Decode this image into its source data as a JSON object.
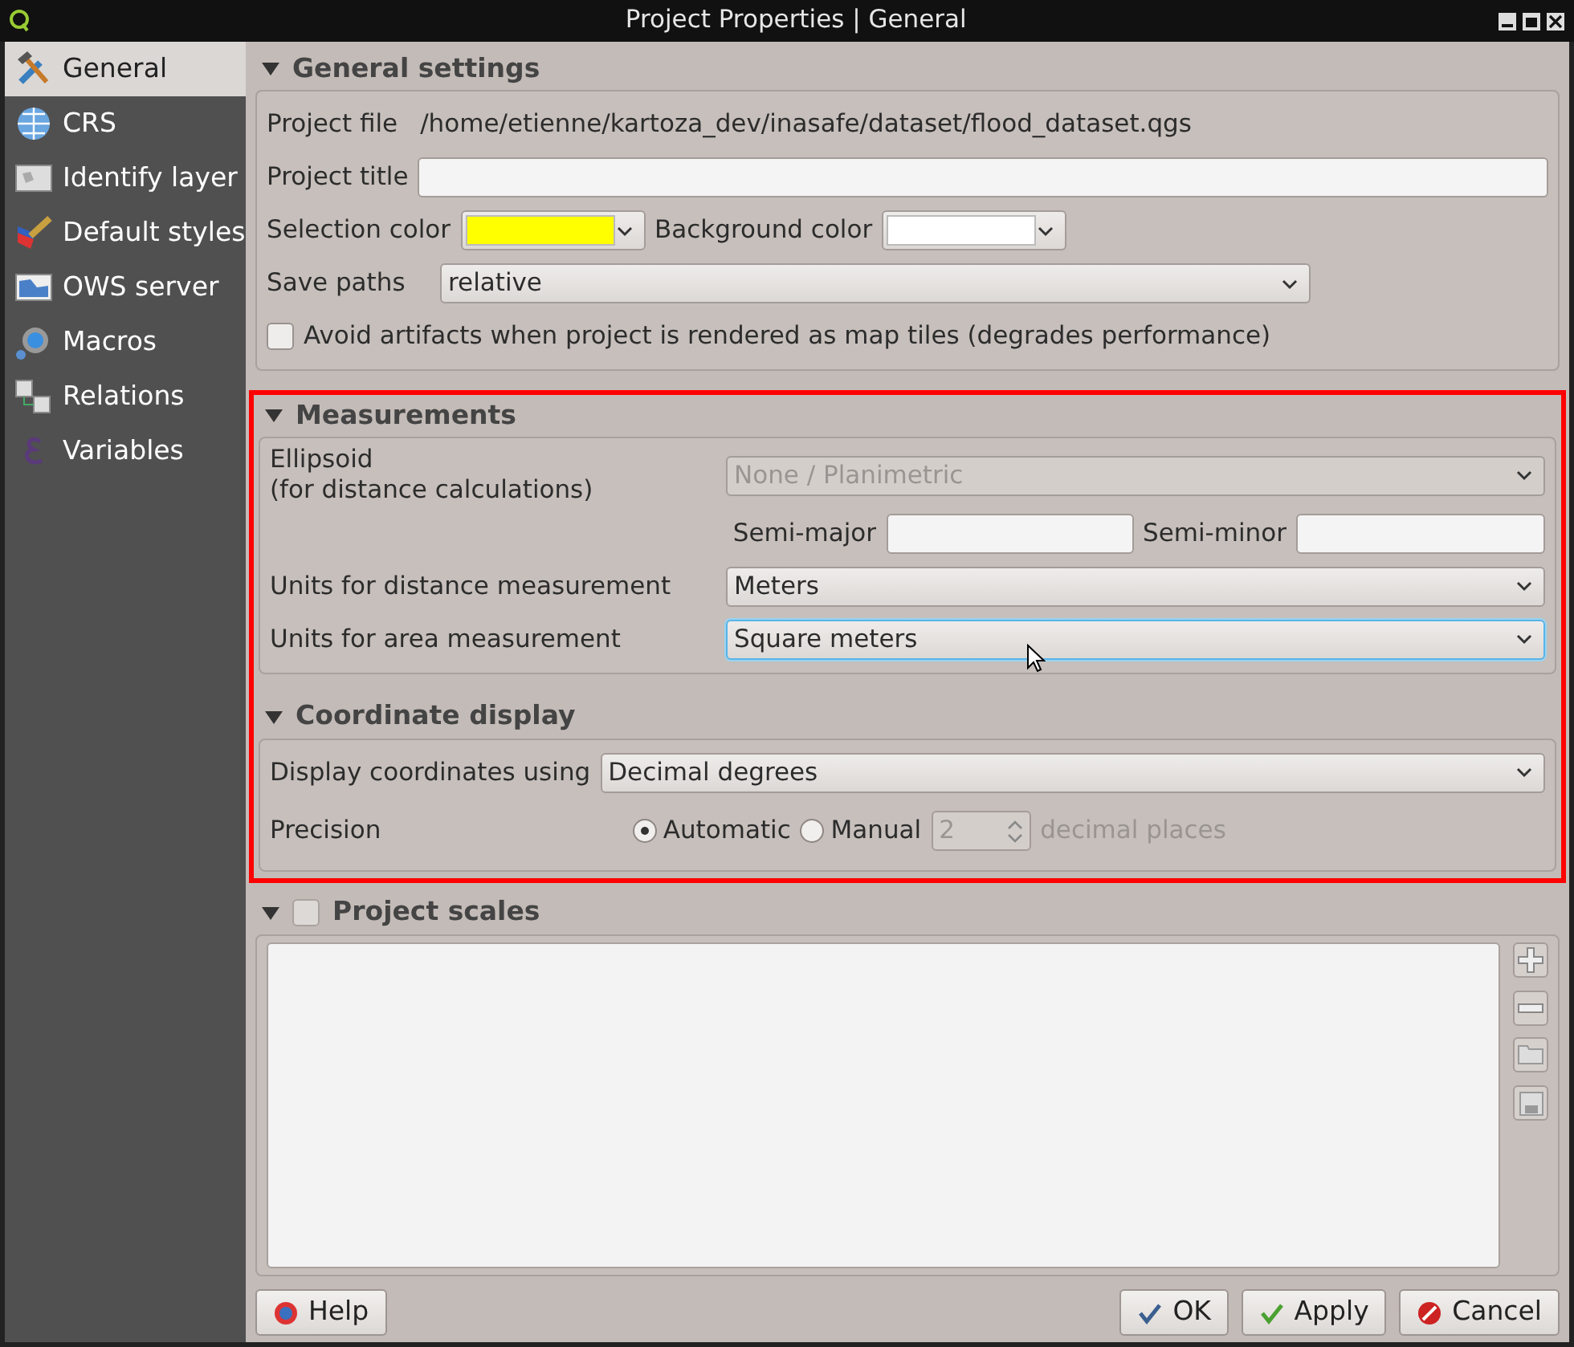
{
  "window": {
    "title": "Project Properties | General"
  },
  "sidebar": {
    "items": [
      {
        "label": "General",
        "selected": true
      },
      {
        "label": "CRS",
        "selected": false
      },
      {
        "label": "Identify layer",
        "selected": false
      },
      {
        "label": "Default styles",
        "selected": false
      },
      {
        "label": "OWS server",
        "selected": false
      },
      {
        "label": "Macros",
        "selected": false
      },
      {
        "label": "Relations",
        "selected": false
      },
      {
        "label": "Variables",
        "selected": false
      }
    ]
  },
  "general_settings": {
    "title": "General settings",
    "expanded": true,
    "project_file": {
      "label": "Project file",
      "value": "/home/etienne/kartoza_dev/inasafe/dataset/flood_dataset.qgs"
    },
    "project_title": {
      "label": "Project title"
    },
    "selection_color": {
      "label": "Selection color",
      "color": "#ffff00"
    },
    "background_color": {
      "label": "Background color",
      "color": "#ffffff"
    },
    "save_paths": {
      "label": "Save paths",
      "value": "relative"
    },
    "avoid_artifacts": {
      "label": "Avoid artifacts when project is rendered as map tiles (degrades performance)",
      "checked": false
    }
  },
  "measurements": {
    "title": "Measurements",
    "expanded": true,
    "highlighted": true,
    "ellipsoid": {
      "label": "Ellipsoid",
      "sublabel": "(for distance calculations)",
      "value": "None / Planimetric",
      "disabled": true
    },
    "semi_major": {
      "label": "Semi-major"
    },
    "semi_minor": {
      "label": "Semi-minor"
    },
    "distance_units": {
      "label": "Units for distance measurement",
      "value": "Meters",
      "focused": false
    },
    "area_units": {
      "label": "Units for area measurement",
      "value": "Square meters",
      "focused": true
    }
  },
  "coordinate_display": {
    "title": "Coordinate display",
    "expanded": true,
    "display_using": {
      "label": "Display coordinates using",
      "value": "Decimal degrees"
    },
    "precision": {
      "label": "Precision",
      "options": [
        {
          "label": "Automatic",
          "selected": true
        },
        {
          "label": "Manual",
          "selected": false
        }
      ],
      "spin_value": "2",
      "spin_disabled": true,
      "suffix": "decimal places"
    }
  },
  "project_scales": {
    "title": "Project scales",
    "expanded": true,
    "checked": false
  },
  "buttons": [
    {
      "label": "Help",
      "kind": "help"
    },
    {
      "label": "OK",
      "kind": "ok"
    },
    {
      "label": "Apply",
      "kind": "apply"
    },
    {
      "label": "Cancel",
      "kind": "cancel"
    }
  ]
}
